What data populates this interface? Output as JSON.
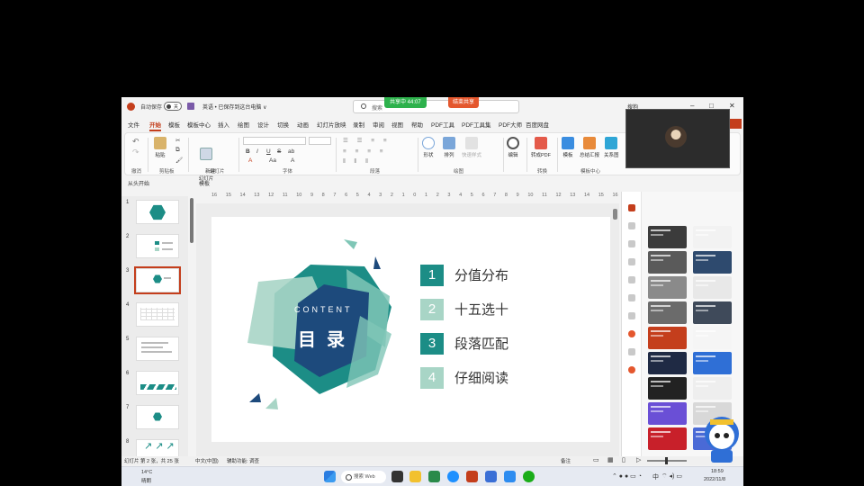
{
  "titlebar": {
    "autosave_label": "自动保存",
    "autosave_state": "关",
    "doc_title": "英语 • 已保存到这台电脑 ∨",
    "search_placeholder": "搜索",
    "share_status": "共享中 44:07",
    "end_share": "结束共享",
    "search_label": "搜狗",
    "minimize": "–",
    "restore": "□",
    "close": "✕"
  },
  "ribbon_tabs": [
    "文件",
    "开始",
    "模板",
    "模板中心",
    "插入",
    "绘图",
    "设计",
    "切换",
    "动画",
    "幻灯片放映",
    "录制",
    "审阅",
    "视图",
    "帮助",
    "PDF工具",
    "PDF工具集",
    "PDF大师",
    "百度网盘"
  ],
  "ribbon": {
    "groups": [
      "撤消",
      "剪贴板",
      "幻灯片",
      "字体",
      "段落",
      "绘图",
      "编辑",
      "转换",
      "模板中心"
    ],
    "paste": "粘贴",
    "new_slide": "新建\n幻灯片",
    "shapes": "形状",
    "arrange": "排列",
    "quick_styles": "快速样式",
    "edit": "编辑",
    "to_pdf": "转成PDF",
    "template": "模板",
    "summary_report": "总结汇报",
    "relation": "关系图",
    "format_buttons": [
      "B",
      "I",
      "U",
      "S",
      "ab",
      "A",
      "Aa",
      "A"
    ]
  },
  "qat": {
    "from_start": "从头开始",
    "template": "模板"
  },
  "slides": [
    {
      "num": "1",
      "kind": "hex"
    },
    {
      "num": "2",
      "kind": "list"
    },
    {
      "num": "3",
      "kind": "hex-small",
      "selected": true
    },
    {
      "num": "4",
      "kind": "table"
    },
    {
      "num": "5",
      "kind": "text"
    },
    {
      "num": "6",
      "kind": "bars"
    },
    {
      "num": "7",
      "kind": "hex-small"
    },
    {
      "num": "8",
      "kind": "arrows"
    }
  ],
  "ruler_ticks": [
    "16",
    "15",
    "14",
    "13",
    "12",
    "11",
    "10",
    "9",
    "8",
    "7",
    "6",
    "5",
    "4",
    "3",
    "2",
    "1",
    "0",
    "1",
    "2",
    "3",
    "4",
    "5",
    "6",
    "7",
    "8",
    "9",
    "10",
    "11",
    "12",
    "13",
    "14",
    "15",
    "16"
  ],
  "slide": {
    "contents_label": "CONTENT",
    "title": "目录",
    "items": [
      {
        "num": "1",
        "text": "分值分布",
        "color": "#1c8d86"
      },
      {
        "num": "2",
        "text": "十五选十",
        "color": "#a8d5c6"
      },
      {
        "num": "3",
        "text": "段落匹配",
        "color": "#1c8d86"
      },
      {
        "num": "4",
        "text": "仔细阅读",
        "color": "#a8d5c6"
      }
    ],
    "colors": {
      "teal": "#1c8d86",
      "dark_blue": "#1d4a7c",
      "light_teal": "#a8d5c6",
      "mint": "#7fc6b6"
    }
  },
  "right_panel": {
    "templates": [
      "#3b3b3b",
      "#f2f2f2",
      "#5a5a5a",
      "#2e4a6e",
      "#8a8a8a",
      "#e8e8e8",
      "#6b6b6b",
      "#3f4a5a",
      "#c43e1c",
      "#f5f5f5",
      "#1f2a44",
      "#2f6fd6",
      "#222222",
      "#eeeeee",
      "#6a4fd6",
      "#d8d8d8",
      "#c8202a",
      "#4a6ad6"
    ]
  },
  "status": {
    "slide_info": "幻灯片 第 2 张，共 25 张",
    "language": "中文(中国)",
    "accessibility": "辅助功能: 调查",
    "notes": "备注",
    "zoom": "—  +"
  },
  "taskbar": {
    "weather_temp": "14°C",
    "weather_desc": "晴朗",
    "search": "搜索 Web",
    "time": "18:59",
    "date": "2022/11/8",
    "tray_lang": "中"
  }
}
